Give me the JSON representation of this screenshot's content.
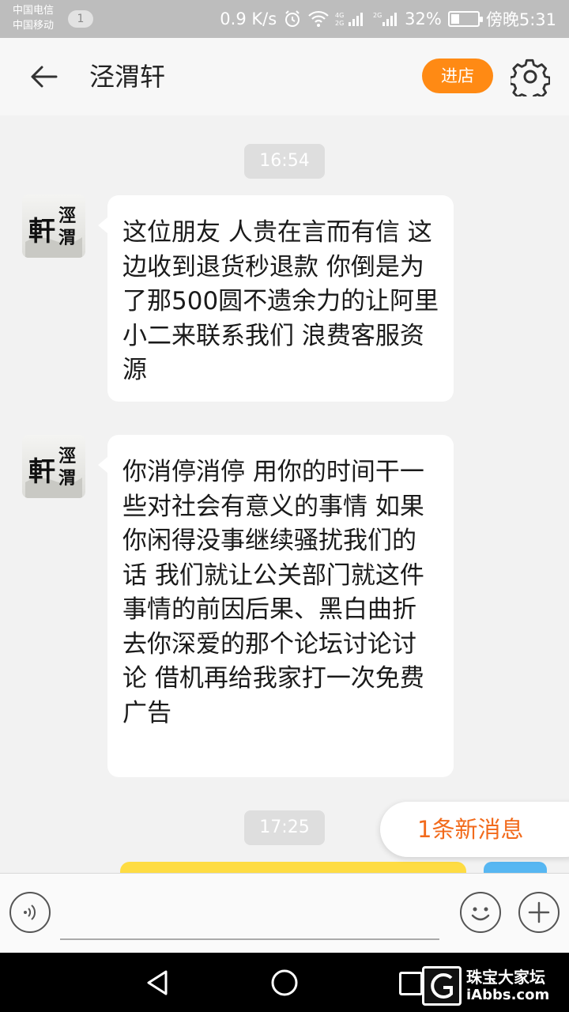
{
  "status_bar": {
    "carrier_1": "中国电信",
    "carrier_2": "中国移动",
    "notification_count": "1",
    "net_speed": "0.9 K/s",
    "battery_percent": "32%",
    "battery_level": 0.32,
    "time": "傍晚5:31"
  },
  "header": {
    "title": "泾渭轩",
    "enter_shop_label": "进店",
    "back_icon": "arrow-left-icon",
    "settings_icon": "gear-icon"
  },
  "chat": {
    "time_1": "16:54",
    "message_1": "这位朋友 人贵在言而有信 这边收到退货秒退款 你倒是为了那500圆不遗余力的让阿里小二来联系我们 浪费客服资源",
    "message_2": "你消停消停 用你的时间干一些对社会有意义的事情 如果你闲得没事继续骚扰我们的话 我们就让公关部门就这件事情的前因后果、黑白曲折去你深爱的那个论坛讨论讨论 借机再给我家打一次免费广告",
    "time_2": "17:25",
    "new_messages_label": "1条新消息"
  },
  "input_bar": {
    "voice_icon": "voice-icon",
    "emoji_icon": "smiley-icon",
    "plus_icon": "plus-icon",
    "text_value": ""
  },
  "watermark": {
    "cn": "珠宝大家坛",
    "en": "iAbbs.com"
  },
  "colors": {
    "accent": "#ff8a14",
    "new_message": "#f26a1b",
    "own_bubble": "#fedc43"
  }
}
